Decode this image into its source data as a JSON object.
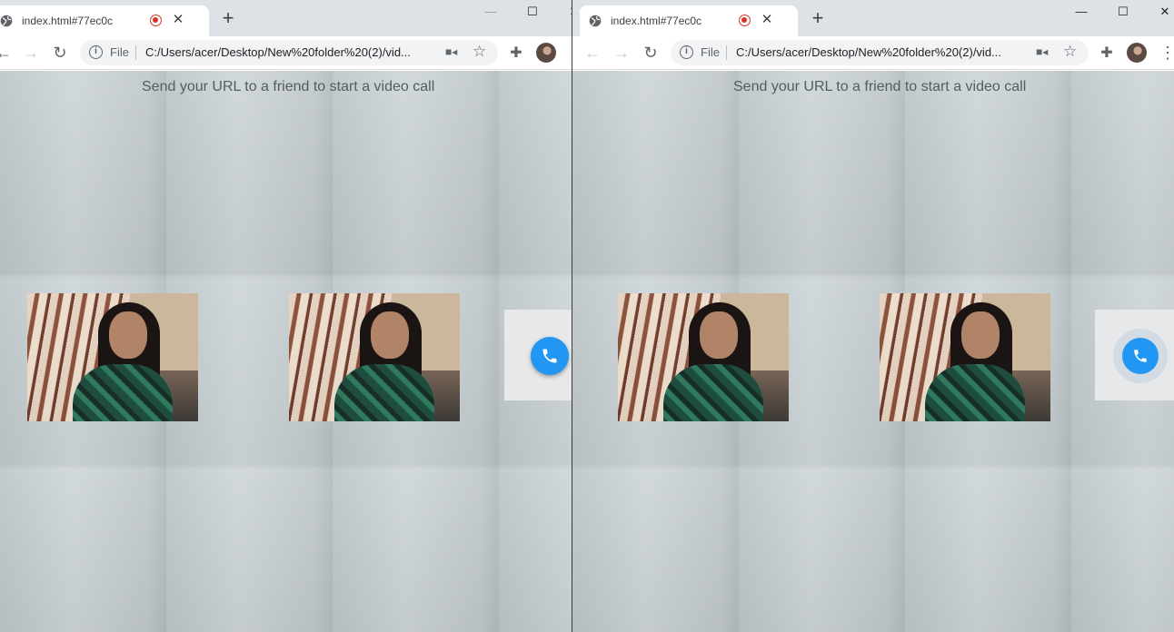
{
  "windows": [
    {
      "tab": {
        "title": "index.html#77ec0c"
      },
      "omnibox": {
        "scheme": "File",
        "url": "C:/Users/acer/Desktop/New%20folder%20(2)/vid..."
      },
      "page": {
        "hint": "Send your URL to a friend to start a video call"
      }
    },
    {
      "tab": {
        "title": "index.html#77ec0c"
      },
      "omnibox": {
        "scheme": "File",
        "url": "C:/Users/acer/Desktop/New%20folder%20(2)/vid..."
      },
      "page": {
        "hint": "Send your URL to a friend to start a video call"
      }
    }
  ],
  "icons": {
    "favicon": "globe-icon",
    "recording": "recording-indicator-icon",
    "close": "close-icon",
    "new_tab": "plus-icon",
    "back": "arrow-left-icon",
    "forward": "arrow-right-icon",
    "reload": "reload-icon",
    "site_info": "info-icon",
    "camera": "video-camera-icon",
    "bookmark": "star-icon",
    "extensions": "puzzle-icon",
    "menu": "kebab-menu-icon",
    "call": "phone-icon"
  },
  "colors": {
    "call_button": "#2196f3",
    "recording": "#d93025"
  }
}
